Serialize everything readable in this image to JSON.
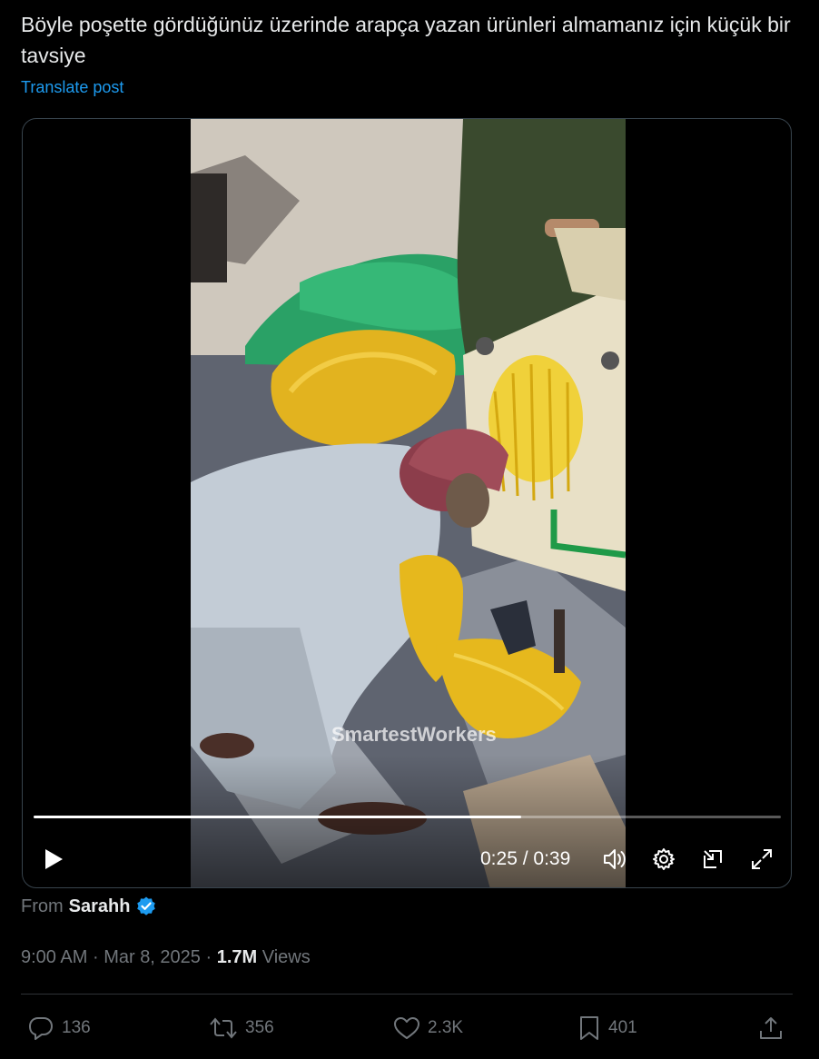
{
  "post": {
    "text": "Böyle poşette gördüğünüz üzerinde arapça yazan ürünleri almamanız için küçük bir tavsiye",
    "translate_label": "Translate post"
  },
  "video": {
    "watermark": "SmartestWorkers",
    "current_time": "0:25",
    "separator": "/",
    "duration": "0:39",
    "progress_fraction": 0.653
  },
  "attribution": {
    "prefix": "From",
    "author": "Sarahh",
    "verified": true
  },
  "meta": {
    "time": "9:00 AM",
    "dot": "·",
    "date": "Mar 8, 2025",
    "views_count": "1.7M",
    "views_label": "Views"
  },
  "actions": {
    "replies": "136",
    "reposts": "356",
    "likes": "2.3K",
    "bookmarks": "401"
  },
  "icons": {
    "play": "play-icon",
    "volume": "volume-icon",
    "settings": "gear-icon",
    "pip": "picture-in-picture-icon",
    "fullscreen": "fullscreen-icon",
    "verified": "verified-badge-icon",
    "reply": "reply-icon",
    "repost": "repost-icon",
    "like": "heart-icon",
    "bookmark": "bookmark-icon",
    "share": "share-icon"
  },
  "colors": {
    "background": "#000000",
    "text": "#e7e9ea",
    "secondary": "#71767b",
    "accent": "#1d9bf0",
    "border": "#2f3336"
  }
}
